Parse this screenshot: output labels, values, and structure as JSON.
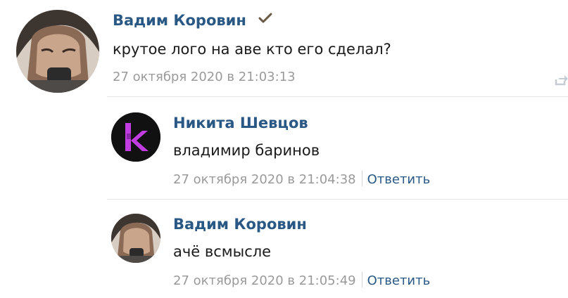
{
  "comments": [
    {
      "author": "Вадим Коровин",
      "verified": true,
      "text": "крутое лого на аве кто его сделал?",
      "date": "27 октября 2020 в 21:03:13"
    },
    {
      "author": "Никита Шевцов",
      "avatar_letter": "k",
      "text": "владимир баринов",
      "date": "27 октября 2020 в 21:04:38",
      "reply": "Ответить"
    },
    {
      "author": "Вадим Коровин",
      "text": "ачё всмысле",
      "date": "27 октября 2020 в 21:05:49",
      "reply": "Ответить"
    }
  ],
  "colors": {
    "author": "#2a5885",
    "text": "#1a1a1a",
    "meta": "#9a9a9a",
    "logo_avatar_bg": "#111111",
    "logo_letter": "#c13de0"
  },
  "icons": {
    "verified": "checkmark-icon",
    "share": "share-icon"
  }
}
